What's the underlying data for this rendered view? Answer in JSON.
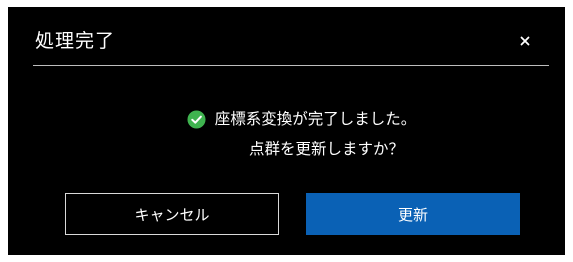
{
  "dialog": {
    "title": "処理完了",
    "close_label": "×",
    "message_line1": "座標系変換が完了しました。",
    "message_line2": "点群を更新しますか？",
    "cancel_label": "キャンセル",
    "update_label": "更新",
    "icons": {
      "status": "check-circle-icon",
      "close": "close-icon"
    },
    "colors": {
      "background": "#000000",
      "primary_button": "#0a61b5",
      "success_icon": "#3fb34f",
      "divider": "#bdbdbd"
    }
  }
}
